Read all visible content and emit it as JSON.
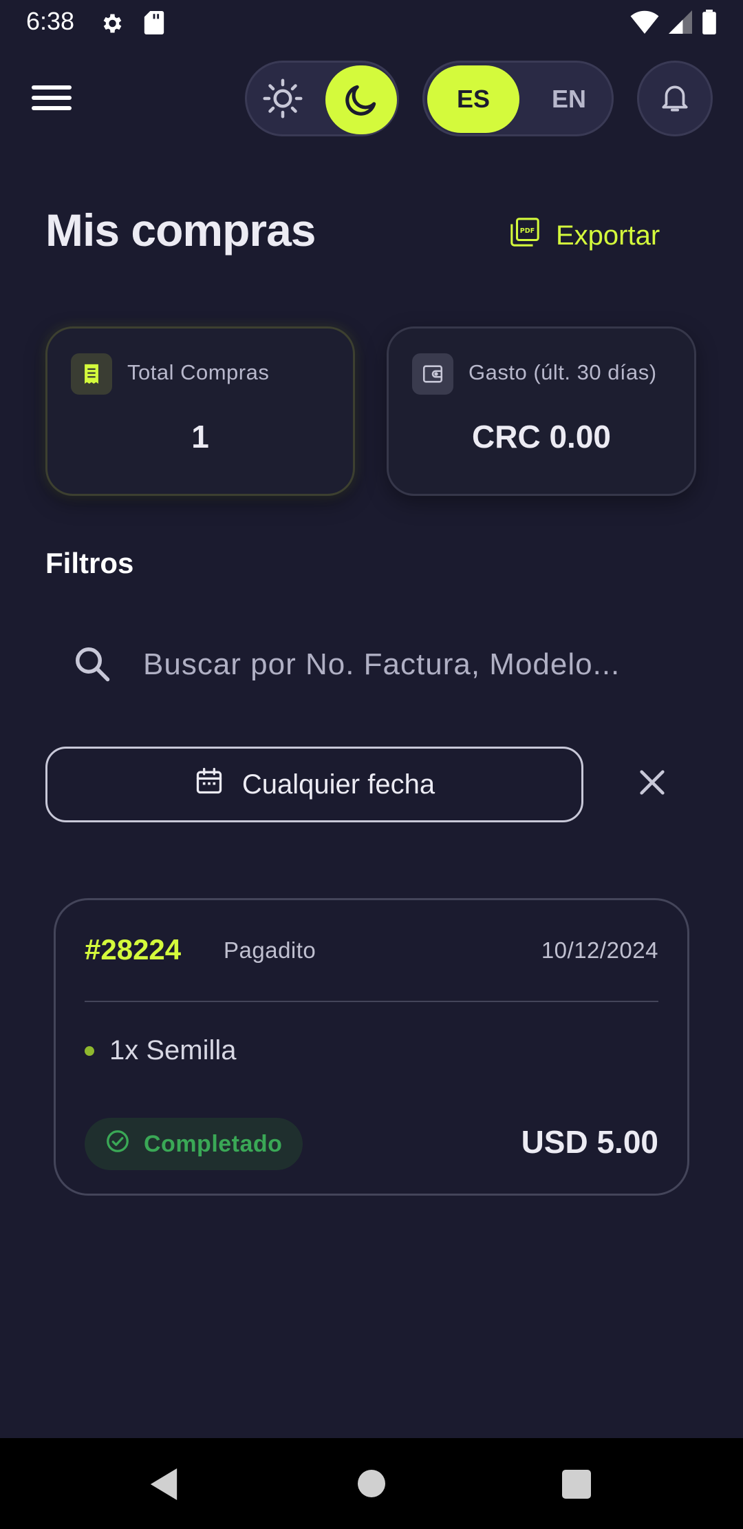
{
  "status_bar": {
    "time": "6:38",
    "icons": [
      "settings-icon",
      "sd-card-icon",
      "wifi-icon",
      "signal-icon",
      "battery-icon"
    ]
  },
  "top_bar": {
    "menu_icon": "hamburger-menu-icon",
    "theme": {
      "light_icon": "sun-icon",
      "dark_icon": "moon-icon",
      "active": "dark"
    },
    "language": {
      "es_label": "ES",
      "en_label": "EN",
      "active": "ES"
    },
    "notification_icon": "bell-icon"
  },
  "header": {
    "title": "Mis compras",
    "export_label": "Exportar",
    "export_icon": "pdf-icon"
  },
  "stats": [
    {
      "icon": "receipt-icon",
      "label": "Total Compras",
      "value": "1"
    },
    {
      "icon": "wallet-icon",
      "label": "Gasto (últ. 30 días)",
      "value": "CRC 0.00"
    }
  ],
  "filters": {
    "title": "Filtros",
    "search_placeholder": "Buscar por No. Factura, Modelo...",
    "search_value": "",
    "date_label": "Cualquier fecha",
    "date_icon": "calendar-icon",
    "clear_icon": "close-icon"
  },
  "purchases": [
    {
      "invoice": "#28224",
      "payment_method": "Pagadito",
      "date": "10/12/2024",
      "items": [
        "1x Semilla"
      ],
      "status": "Completado",
      "status_icon": "check-circle-icon",
      "total": "USD 5.00"
    }
  ],
  "colors": {
    "background": "#1b1b2f",
    "accent": "#d4fa3c",
    "success": "#3aa856",
    "card_border": "#44455a"
  },
  "nav_bar": {
    "icons": [
      "back-icon",
      "home-icon",
      "recents-icon"
    ]
  }
}
